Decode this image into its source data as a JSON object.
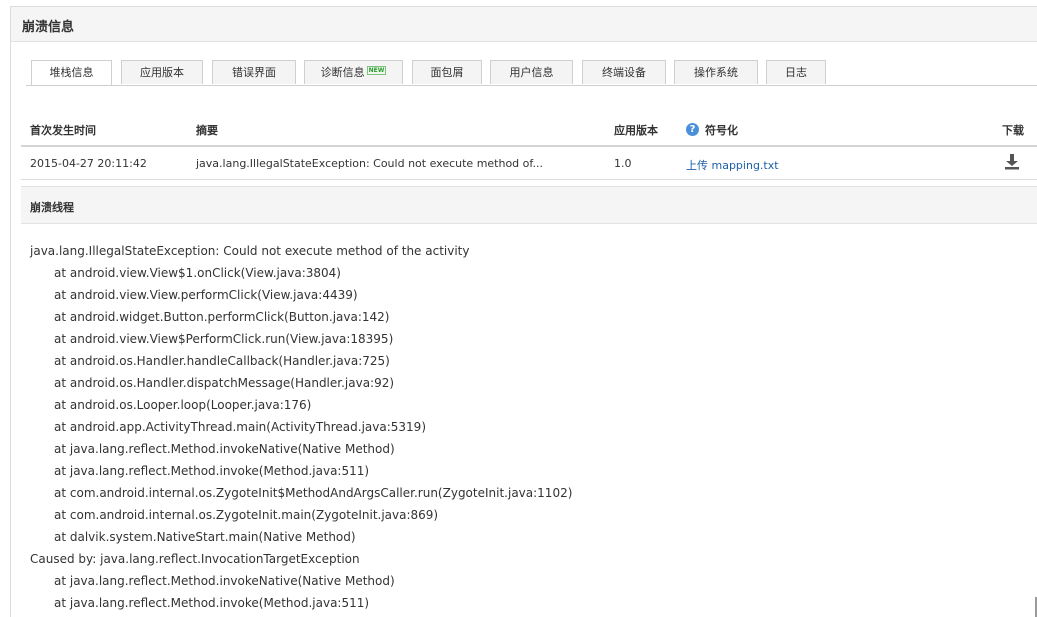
{
  "header": {
    "title": "崩溃信息"
  },
  "tabs": [
    {
      "label": "堆栈信息",
      "active": true
    },
    {
      "label": "应用版本"
    },
    {
      "label": "错误界面"
    },
    {
      "label": "诊断信息",
      "badge": "NEW"
    },
    {
      "label": "面包屑"
    },
    {
      "label": "用户信息"
    },
    {
      "label": "终端设备"
    },
    {
      "label": "操作系统"
    },
    {
      "label": "日志"
    }
  ],
  "table": {
    "columns": [
      "首次发生时间",
      "摘要",
      "应用版本",
      "符号化",
      "下载"
    ],
    "row": {
      "first_time": "2015-04-27 20:11:42",
      "summary": "java.lang.IllegalStateException: Could not execute method of...",
      "version": "1.0",
      "symbolicate_link": "上传 mapping.txt"
    }
  },
  "section": {
    "title": "崩溃线程"
  },
  "stack": [
    {
      "text": "java.lang.IllegalStateException: Could not execute method of the activity",
      "indent": false
    },
    {
      "text": "at android.view.View$1.onClick(View.java:3804)",
      "indent": true
    },
    {
      "text": "at android.view.View.performClick(View.java:4439)",
      "indent": true
    },
    {
      "text": "at android.widget.Button.performClick(Button.java:142)",
      "indent": true
    },
    {
      "text": "at android.view.View$PerformClick.run(View.java:18395)",
      "indent": true
    },
    {
      "text": "at android.os.Handler.handleCallback(Handler.java:725)",
      "indent": true
    },
    {
      "text": "at android.os.Handler.dispatchMessage(Handler.java:92)",
      "indent": true
    },
    {
      "text": "at android.os.Looper.loop(Looper.java:176)",
      "indent": true
    },
    {
      "text": "at android.app.ActivityThread.main(ActivityThread.java:5319)",
      "indent": true
    },
    {
      "text": "at java.lang.reflect.Method.invokeNative(Native Method)",
      "indent": true
    },
    {
      "text": "at java.lang.reflect.Method.invoke(Method.java:511)",
      "indent": true
    },
    {
      "text": "at com.android.internal.os.ZygoteInit$MethodAndArgsCaller.run(ZygoteInit.java:1102)",
      "indent": true
    },
    {
      "text": "at com.android.internal.os.ZygoteInit.main(ZygoteInit.java:869)",
      "indent": true
    },
    {
      "text": "at dalvik.system.NativeStart.main(Native Method)",
      "indent": true
    },
    {
      "text": "Caused by: java.lang.reflect.InvocationTargetException",
      "indent": false
    },
    {
      "text": "at java.lang.reflect.Method.invokeNative(Native Method)",
      "indent": true
    },
    {
      "text": "at java.lang.reflect.Method.invoke(Method.java:511)",
      "indent": true
    }
  ]
}
